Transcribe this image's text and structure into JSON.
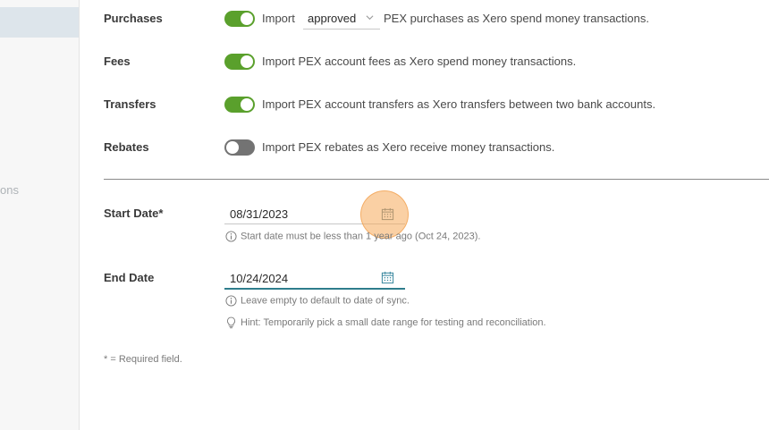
{
  "sidebar": {
    "partial_item_text": "ons"
  },
  "settings": {
    "purchases": {
      "label": "Purchases",
      "enabled": true,
      "prefix": "Import",
      "status_select": "approved",
      "suffix": "PEX purchases as Xero spend money transactions."
    },
    "fees": {
      "label": "Fees",
      "enabled": true,
      "description": "Import PEX account fees as Xero spend money transactions."
    },
    "transfers": {
      "label": "Transfers",
      "enabled": true,
      "description": "Import PEX account transfers as Xero transfers between two bank accounts."
    },
    "rebates": {
      "label": "Rebates",
      "enabled": false,
      "description": "Import PEX rebates as Xero receive money transactions."
    }
  },
  "dates": {
    "start": {
      "label": "Start Date*",
      "value": "08/31/2023",
      "hint": "Start date must be less than 1 year ago (Oct 24, 2023)."
    },
    "end": {
      "label": "End Date",
      "value": "10/24/2024",
      "hint": "Leave empty to default to date of sync.",
      "tip": "Hint: Temporarily pick a small date range for testing and reconciliation."
    }
  },
  "footer": {
    "required_note": "* = Required field."
  },
  "colors": {
    "toggle_on": "#5aa02c",
    "toggle_off": "#737373",
    "focus_underline": "#2e7d8c",
    "click_highlight": "#f6aa5a"
  },
  "icons": [
    "calendar-icon",
    "info-icon",
    "lightbulb-icon",
    "chevron-down-icon"
  ]
}
